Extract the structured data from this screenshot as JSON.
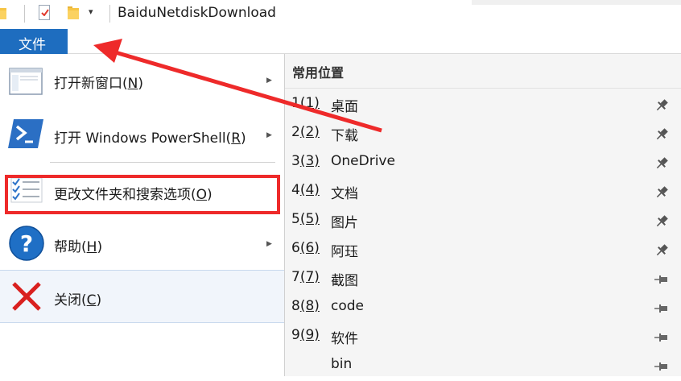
{
  "window": {
    "title": "BaiduNetdiskDownload",
    "dropdown_glyph": "▾"
  },
  "ribbon": {
    "file_tab": "文件"
  },
  "file_menu": {
    "items": [
      {
        "label": "打开新窗口(N)",
        "text": "打开新窗口(",
        "key": "N",
        "tail": ")",
        "icon": "new-window-icon",
        "has_submenu": true
      },
      {
        "label": "打开 Windows PowerShell(R)",
        "text": "打开 Windows PowerShell(",
        "key": "R",
        "tail": ")",
        "icon": "powershell-icon",
        "has_submenu": true
      },
      {
        "label": "更改文件夹和搜索选项(O)",
        "text": "更改文件夹和搜索选项(",
        "key": "O",
        "tail": ")",
        "icon": "folder-options-icon",
        "has_submenu": false
      },
      {
        "label": "帮助(H)",
        "text": "帮助(",
        "key": "H",
        "tail": ")",
        "icon": "help-icon",
        "has_submenu": true
      },
      {
        "label": "关闭(C)",
        "text": "关闭(",
        "key": "C",
        "tail": ")",
        "icon": "close-icon",
        "has_submenu": false
      }
    ],
    "submenu_arrow": "▶"
  },
  "frequent_places": {
    "header": "常用位置",
    "items": [
      {
        "num": "1",
        "key": "(1)",
        "name": "桌面",
        "pinned": true
      },
      {
        "num": "2",
        "key": "(2)",
        "name": "下载",
        "pinned": true
      },
      {
        "num": "3",
        "key": "(3)",
        "name": "OneDrive",
        "pinned": true
      },
      {
        "num": "4",
        "key": "(4)",
        "name": "文档",
        "pinned": true
      },
      {
        "num": "5",
        "key": "(5)",
        "name": "图片",
        "pinned": true
      },
      {
        "num": "6",
        "key": "(6)",
        "name": "阿珏",
        "pinned": true
      },
      {
        "num": "7",
        "key": "(7)",
        "name": "截图",
        "pinned": false
      },
      {
        "num": "8",
        "key": "(8)",
        "name": "code",
        "pinned": false
      },
      {
        "num": "9",
        "key": "(9)",
        "name": "软件",
        "pinned": false
      },
      {
        "num": "",
        "key": "",
        "name": "bin",
        "pinned": false
      }
    ]
  },
  "colors": {
    "file_tab": "#1e6dbf",
    "annotation_red": "#ee2a2a",
    "close_highlight": "#f1f5fb"
  }
}
